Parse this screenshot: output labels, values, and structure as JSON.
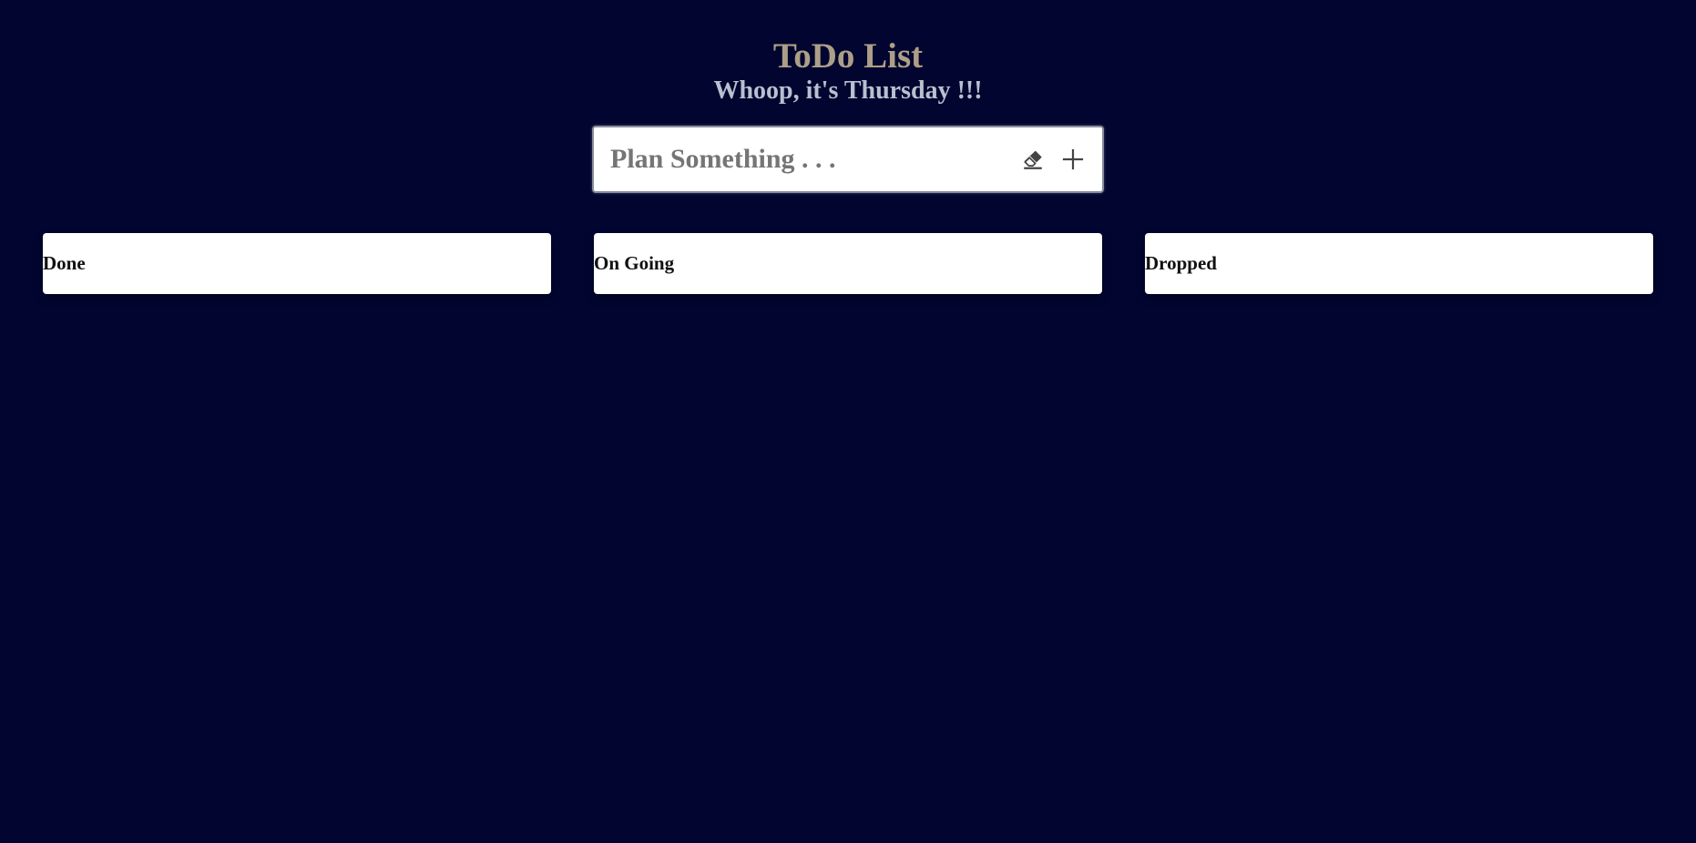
{
  "header": {
    "title": "ToDo List",
    "subtitle": "Whoop, it's Thursday !!!"
  },
  "composer": {
    "placeholder": "Plan Something . . .",
    "value": "",
    "clear_icon": "eraser-icon",
    "add_icon": "plus-icon"
  },
  "columns": [
    {
      "label": "Done"
    },
    {
      "label": "On Going"
    },
    {
      "label": "Dropped"
    }
  ],
  "colors": {
    "background": "#020530",
    "title": "#ad9f87",
    "subtitle": "#b7c1cf",
    "card": "#ffffff",
    "icon": "#444444"
  }
}
